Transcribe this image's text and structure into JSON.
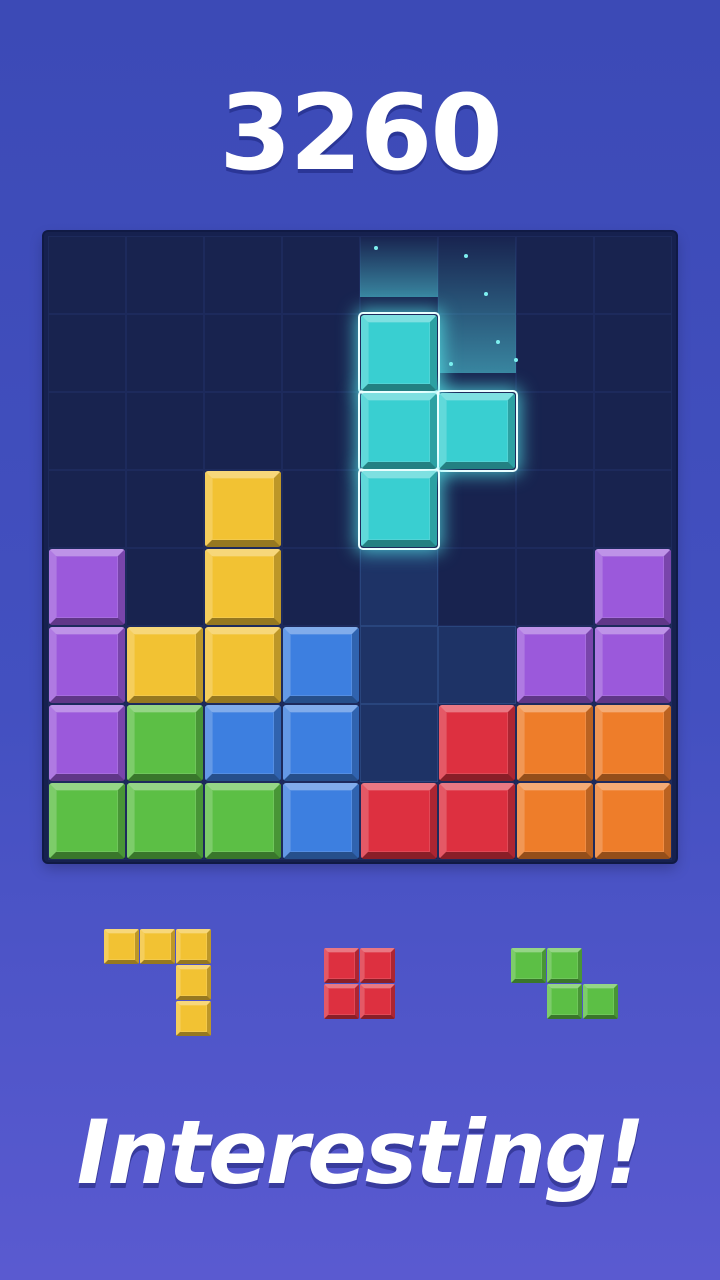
{
  "score": "3260",
  "tagline": "Interesting!",
  "colors": {
    "purple": "#9b59db",
    "yellow": "#f2c233",
    "blue": "#3d7fe0",
    "green": "#5cbf45",
    "red": "#dd3040",
    "orange": "#ee7d2a",
    "cyan": "#39cfd1"
  },
  "board": {
    "columns": 8,
    "rows": 8,
    "placed_blocks": [
      {
        "row": 3,
        "col": 2,
        "color": "yellow"
      },
      {
        "row": 4,
        "col": 0,
        "color": "purple"
      },
      {
        "row": 4,
        "col": 2,
        "color": "yellow"
      },
      {
        "row": 4,
        "col": 7,
        "color": "purple"
      },
      {
        "row": 5,
        "col": 0,
        "color": "purple"
      },
      {
        "row": 5,
        "col": 1,
        "color": "yellow"
      },
      {
        "row": 5,
        "col": 2,
        "color": "yellow"
      },
      {
        "row": 5,
        "col": 3,
        "color": "blue"
      },
      {
        "row": 5,
        "col": 6,
        "color": "purple"
      },
      {
        "row": 5,
        "col": 7,
        "color": "purple"
      },
      {
        "row": 6,
        "col": 0,
        "color": "purple"
      },
      {
        "row": 6,
        "col": 1,
        "color": "green"
      },
      {
        "row": 6,
        "col": 2,
        "color": "blue"
      },
      {
        "row": 6,
        "col": 3,
        "color": "blue"
      },
      {
        "row": 6,
        "col": 5,
        "color": "red"
      },
      {
        "row": 6,
        "col": 6,
        "color": "orange"
      },
      {
        "row": 6,
        "col": 7,
        "color": "orange"
      },
      {
        "row": 7,
        "col": 0,
        "color": "green"
      },
      {
        "row": 7,
        "col": 1,
        "color": "green"
      },
      {
        "row": 7,
        "col": 2,
        "color": "green"
      },
      {
        "row": 7,
        "col": 3,
        "color": "blue"
      },
      {
        "row": 7,
        "col": 4,
        "color": "red"
      },
      {
        "row": 7,
        "col": 5,
        "color": "red"
      },
      {
        "row": 7,
        "col": 6,
        "color": "orange"
      },
      {
        "row": 7,
        "col": 7,
        "color": "orange"
      }
    ],
    "active_piece": {
      "color": "cyan",
      "cells": [
        {
          "row": 1,
          "col": 4
        },
        {
          "row": 2,
          "col": 4
        },
        {
          "row": 2,
          "col": 5
        },
        {
          "row": 3,
          "col": 4
        }
      ]
    },
    "drop_preview_cells": [
      {
        "row": 4,
        "col": 4
      },
      {
        "row": 5,
        "col": 4
      },
      {
        "row": 5,
        "col": 5
      },
      {
        "row": 6,
        "col": 4
      }
    ]
  },
  "next_pieces": [
    {
      "name": "yellow-j-piece",
      "color": "yellow",
      "cells": [
        [
          0,
          0
        ],
        [
          0,
          1
        ],
        [
          0,
          2
        ],
        [
          1,
          2
        ],
        [
          2,
          2
        ]
      ]
    },
    {
      "name": "red-square-piece",
      "color": "red",
      "cells": [
        [
          0,
          0
        ],
        [
          0,
          1
        ],
        [
          1,
          0
        ],
        [
          1,
          1
        ]
      ]
    },
    {
      "name": "green-z-piece",
      "color": "green",
      "cells": [
        [
          0,
          0
        ],
        [
          0,
          1
        ],
        [
          1,
          1
        ],
        [
          1,
          2
        ]
      ]
    }
  ]
}
